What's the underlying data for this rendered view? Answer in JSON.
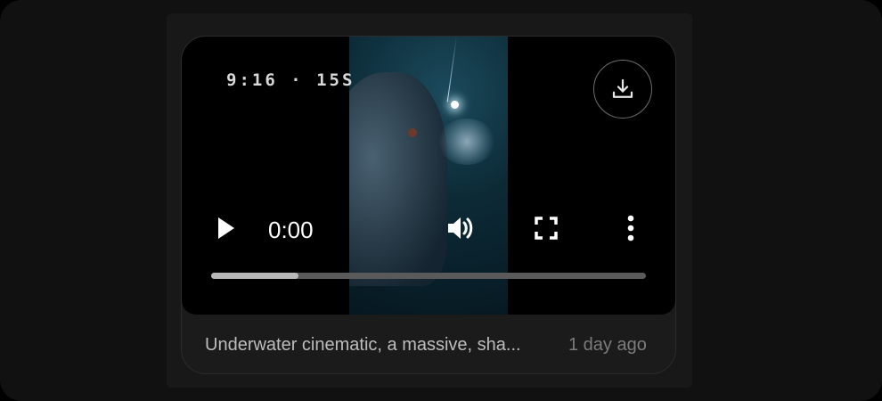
{
  "video": {
    "badge": "9:16 · 15S",
    "time": "0:00",
    "progress_fraction": 0.2
  },
  "card": {
    "caption": "Underwater cinematic, a massive, sha...",
    "age": "1 day ago"
  },
  "icons": {
    "download": "download-icon",
    "play": "play-icon",
    "volume": "volume-icon",
    "fullscreen": "fullscreen-icon",
    "more": "more-vertical-icon"
  },
  "colors": {
    "background": "#111111",
    "panel": "#181818",
    "card": "#1b1b1b",
    "progress_track": "#5a5a5a",
    "progress_fill": "#b8b8b8"
  }
}
